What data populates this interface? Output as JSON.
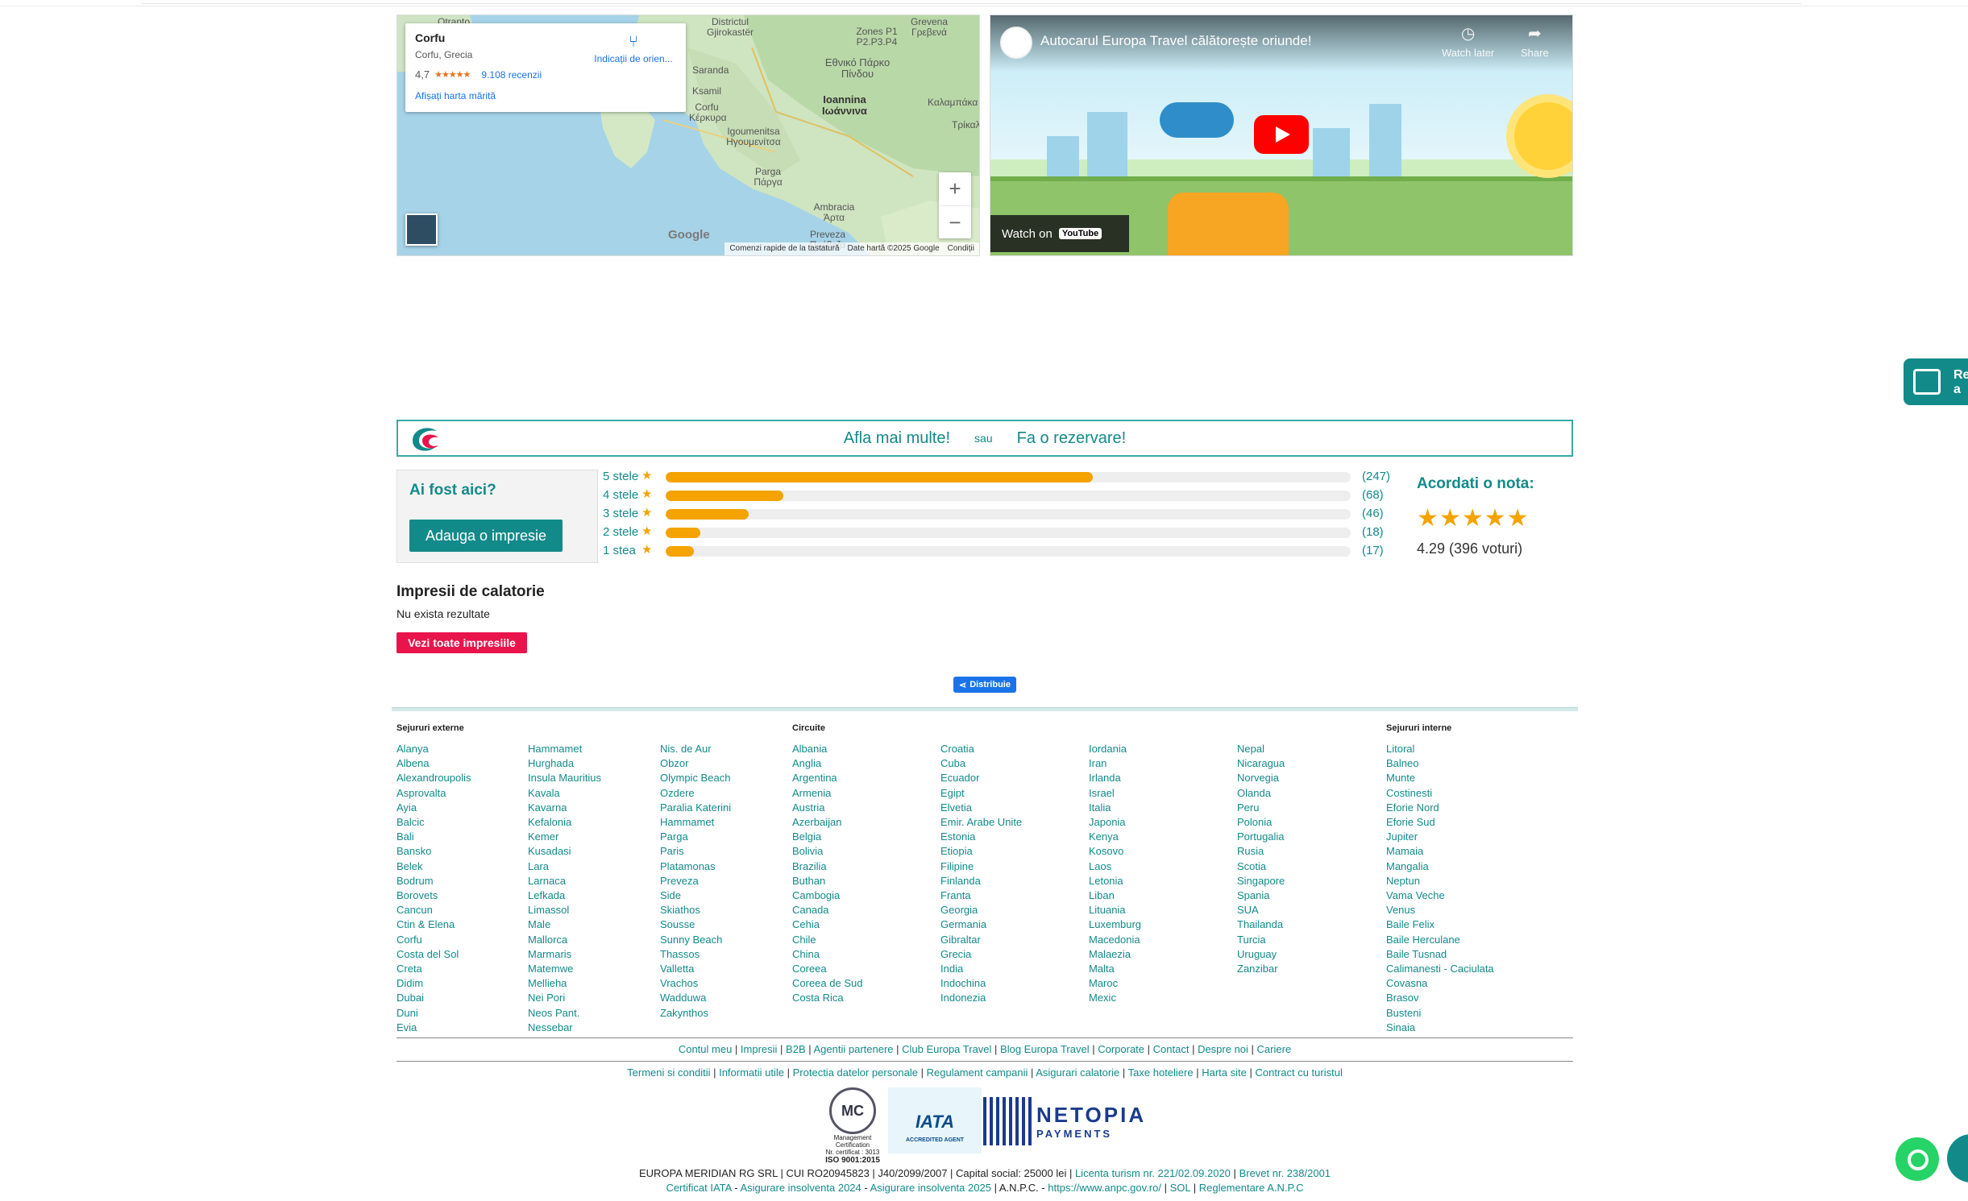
{
  "map": {
    "place": "Corfu",
    "region": "Corfu, Grecia",
    "rating": "4,7",
    "stars": "★★★★★",
    "reviews": "9.108 recenzii",
    "directions": "Indicații de orien...",
    "larger_map": "Afișați harta mărită",
    "zoom_in": "+",
    "zoom_out": "−",
    "google": "Google",
    "shortcuts": "Comenzi rapide de la tastatură",
    "map_data": "Date hartă ©2025 Google",
    "terms": "Condiții",
    "labels": [
      "Otranto",
      "Districtul Gjirokastër",
      "Zones P1 P2.P3.P4",
      "Grevena Γρεβενά",
      "Εθνικό Πάρκο Πίνδου",
      "Saranda",
      "Ksamil",
      "Ioannina Ιωάννινα",
      "Καλαμπάκα",
      "Corfu Κέρκυρα",
      "Igoumenitsa Ηγουμενίτσα",
      "Τρίκαλ",
      "Parga Πάργα",
      "Ambracia Άρτα",
      "Preveza Πρέβεζα"
    ]
  },
  "video": {
    "title": "Autocarul Europa Travel călătorește oriunde!",
    "watch_later": "Watch later",
    "share": "Share",
    "watch_on": "Watch on",
    "youtube": "YouTube"
  },
  "side_widget": {
    "line1": "Re",
    "line2": "a"
  },
  "cta": {
    "learn_more": "Afla mai multe!",
    "or": "sau",
    "book": "Fa o rezervare!"
  },
  "rating": {
    "been_here": "Ai fost aici?",
    "add_review": "Adauga o impresie",
    "rows": [
      {
        "label": "5 stele",
        "count": "(247)",
        "fraction": 0.624
      },
      {
        "label": "4 stele",
        "count": "(68)",
        "fraction": 0.172
      },
      {
        "label": "3 stele",
        "count": "(46)",
        "fraction": 0.121
      },
      {
        "label": "2 stele",
        "count": "(18)",
        "fraction": 0.051
      },
      {
        "label": "1 stea",
        "count": "(17)",
        "fraction": 0.041
      }
    ],
    "give_rating": "Acordati o nota:",
    "stars": "★★★★★",
    "score": "4.29 (396 voturi)"
  },
  "impressions": {
    "title": "Impresii de calatorie",
    "empty": "Nu exista rezultate",
    "see_all": "Vezi toate impresiile",
    "share": "Distribuie"
  },
  "footer": {
    "external_title": "Sejururi externe",
    "circuits_title": "Circuite",
    "internal_title": "Sejururi interne",
    "external": [
      [
        "Alanya",
        "Albena",
        "Alexandroupolis",
        "Asprovalta",
        "Ayia",
        "Balcic",
        "Bali",
        "Bansko",
        "Belek",
        "Bodrum",
        "Borovets",
        "Cancun",
        "Ctin & Elena",
        "Corfu",
        "Costa del Sol",
        "Creta",
        "Didim",
        "Dubai",
        "Duni",
        "Evia"
      ],
      [
        "Hammamet",
        "Hurghada",
        "Insula Mauritius",
        "Kavala",
        "Kavarna",
        "Kefalonia",
        "Kemer",
        "Kusadasi",
        "Lara",
        "Larnaca",
        "Lefkada",
        "Limassol",
        "Male",
        "Mallorca",
        "Marmaris",
        "Matemwe",
        "Mellieha",
        "Nei Pori",
        "Neos Pant.",
        "Nessebar"
      ],
      [
        "Nis. de Aur",
        "Obzor",
        "Olympic Beach",
        "Ozdere",
        "Paralia Katerini",
        "Hammamet",
        "Parga",
        "Paris",
        "Platamonas",
        "Preveza",
        "Side",
        "Skiathos",
        "Sousse",
        "Sunny Beach",
        "Thassos",
        "Valletta",
        "Vrachos",
        "Wadduwa",
        "Zakynthos"
      ]
    ],
    "circuits": [
      [
        "Albania",
        "Anglia",
        "Argentina",
        "Armenia",
        "Austria",
        "Azerbaijan",
        "Belgia",
        "Bolivia",
        "Brazilia",
        "Buthan",
        "Cambogia",
        "Canada",
        "Cehia",
        "Chile",
        "China",
        "Coreea",
        "Coreea de Sud",
        "Costa Rica"
      ],
      [
        "Croatia",
        "Cuba",
        "Ecuador",
        "Egipt",
        "Elvetia",
        "Emir. Arabe Unite",
        "Estonia",
        "Etiopia",
        "Filipine",
        "Finlanda",
        "Franta",
        "Georgia",
        "Germania",
        "Gibraltar",
        "Grecia",
        "India",
        "Indochina",
        "Indonezia"
      ],
      [
        "Iordania",
        "Iran",
        "Irlanda",
        "Israel",
        "Italia",
        "Japonia",
        "Kenya",
        "Kosovo",
        "Laos",
        "Letonia",
        "Liban",
        "Lituania",
        "Luxemburg",
        "Macedonia",
        "Malaezia",
        "Malta",
        "Maroc",
        "Mexic"
      ],
      [
        "Nepal",
        "Nicaragua",
        "Norvegia",
        "Olanda",
        "Peru",
        "Polonia",
        "Portugalia",
        "Rusia",
        "Scotia",
        "Singapore",
        "Spania",
        "SUA",
        "Thailanda",
        "Turcia",
        "Uruguay",
        "Zanzibar"
      ]
    ],
    "internal": [
      "Litoral",
      "Balneo",
      "Munte",
      "Costinesti",
      "Eforie Nord",
      "Eforie Sud",
      "Jupiter",
      "Mamaia",
      "Mangalia",
      "Neptun",
      "Vama Veche",
      "Venus",
      "Baile Felix",
      "Baile Herculane",
      "Baile Tusnad",
      "Calimanesti - Caciulata",
      "Covasna",
      "Brasov",
      "Busteni",
      "Sinaia"
    ],
    "links1": [
      "Contul meu",
      "Impresii",
      "B2B",
      "Agentii partenere",
      "Club Europa Travel",
      "Blog Europa Travel",
      "Corporate",
      "Contact",
      "Despre noi",
      "Cariere"
    ],
    "links2": [
      "Termeni si conditii",
      "Informatii utile",
      "Protectia datelor personale",
      "Regulament campanii",
      "Asigurari calatorie",
      "Taxe hoteliere",
      "Harta site",
      "Contract cu turistul"
    ],
    "mc": {
      "logo": "MC",
      "line1": "Management",
      "line2": "Certification",
      "cert": "Nr. certificat : 3013",
      "iso": "ISO 9001:2015"
    },
    "iata": {
      "name": "IATA",
      "sub": "ACCREDITED AGENT"
    },
    "netopia": {
      "name": "NETOPIA",
      "sub": "PAYMENTS"
    },
    "legal1_text": "EUROPA MERIDIAN RG SRL | CUI RO20945823 | J40/2099/2007 | Capital social: 25000 lei |",
    "legal1_lic": "Licenta turism nr. 221/02.09.2020",
    "legal1_sep": "|",
    "legal1_brevet": "Brevet nr. 238/2001",
    "legal2": [
      "Certificat IATA",
      "Asigurare insolventa 2024",
      "Asigurare insolventa 2025"
    ],
    "legal2_anpc": "| A.N.P.C. -",
    "legal2_url": "https://www.anpc.gov.ro/",
    "legal2_sol": "SOL",
    "legal2_reg": "Reglementare A.N.P.C"
  }
}
